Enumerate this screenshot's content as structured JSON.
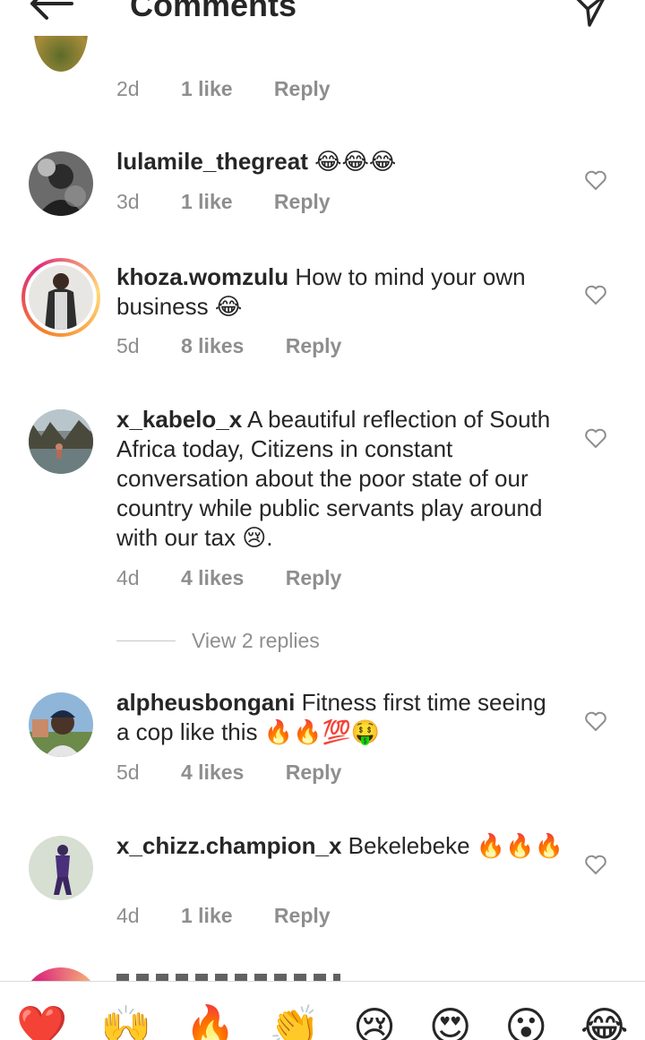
{
  "header": {
    "title": "Comments"
  },
  "top_partial": {
    "time": "2d",
    "likes": "1 like",
    "reply": "Reply"
  },
  "comments": [
    {
      "username": "lulamile_thegreat",
      "text": "",
      "emoji": "😂😂😂",
      "time": "3d",
      "likes": "1 like",
      "reply": "Reply"
    },
    {
      "username": "khoza.womzulu",
      "text": "How to mind your own business",
      "emoji": "😂",
      "time": "5d",
      "likes": "8 likes",
      "reply": "Reply"
    },
    {
      "username": "x_kabelo_x",
      "text": "A beautiful reflection of South Africa today, Citizens in constant conversation about the poor state of our country while public servants play around with our tax",
      "emoji": "😢",
      "tail": ".",
      "time": "4d",
      "likes": "4 likes",
      "reply": "Reply"
    },
    {
      "username": "alpheusbongani",
      "text": "Fitness first time seeing a cop like this",
      "emoji": "🔥🔥💯🤑",
      "time": "5d",
      "likes": "4 likes",
      "reply": "Reply"
    },
    {
      "username": "x_chizz.champion_x",
      "text": "Bekelebeke",
      "emoji": "🔥🔥🔥",
      "time": "4d",
      "likes": "1 like",
      "reply": "Reply"
    }
  ],
  "view_replies": "View 2 replies",
  "reaction_bar": {
    "emojis": [
      "❤️",
      "🙌",
      "🔥",
      "👏",
      "😢",
      "😍",
      "😮",
      "😂"
    ]
  },
  "icons": {
    "back": "back-arrow-icon",
    "send": "paper-plane-icon",
    "like": "heart-outline-icon"
  },
  "colors": {
    "text": "#262626",
    "meta": "#8e8e8e",
    "story_ring": "#dd2a7b"
  }
}
